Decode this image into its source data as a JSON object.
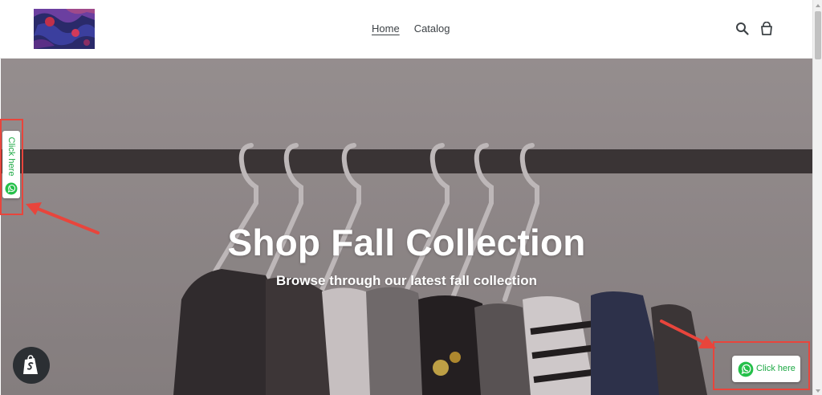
{
  "header": {
    "nav": [
      {
        "label": "Home",
        "active": true
      },
      {
        "label": "Catalog",
        "active": false
      }
    ],
    "icons": [
      "search-icon",
      "cart-icon"
    ]
  },
  "hero": {
    "title": "Shop Fall Collection",
    "subtitle": "Browse through our latest fall collection"
  },
  "whatsapp_side_button": {
    "label": "Click here",
    "icon": "whatsapp-icon"
  },
  "whatsapp_floating_button": {
    "label": "Click here",
    "icon": "whatsapp-icon"
  },
  "shopify_badge": {
    "icon": "shopify-icon"
  },
  "colors": {
    "whatsapp_green": "#1ea945",
    "annotation_red": "#e8453c",
    "nav_text": "#3d4246",
    "hero_overlay": "#a39c9d"
  }
}
